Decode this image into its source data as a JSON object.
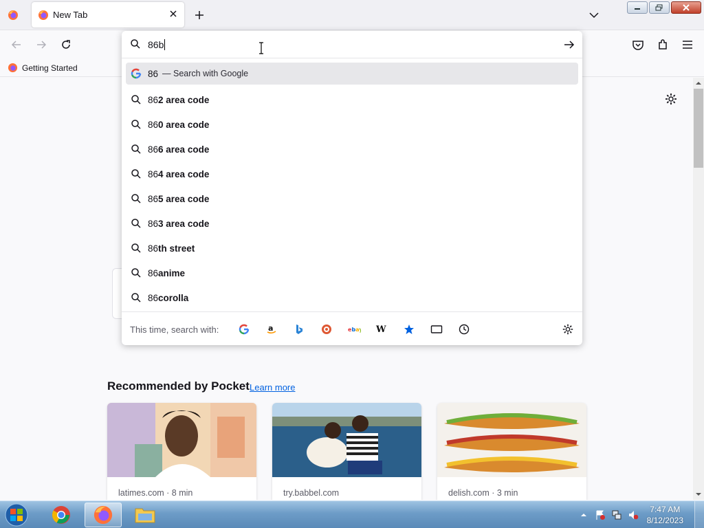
{
  "browser": {
    "tab": {
      "title": "New Tab"
    },
    "bookmarks": [
      {
        "label": "Getting Started"
      }
    ]
  },
  "urlbar": {
    "typed": "86b",
    "suggestions": [
      {
        "typed": "86",
        "completion": "",
        "action": "— Search with Google",
        "icon": "google-icon",
        "active": true
      },
      {
        "typed": "86",
        "completion": "2 area code",
        "icon": "search-icon"
      },
      {
        "typed": "86",
        "completion": "0 area code",
        "icon": "search-icon"
      },
      {
        "typed": "86",
        "completion": "6 area code",
        "icon": "search-icon"
      },
      {
        "typed": "86",
        "completion": "4 area code",
        "icon": "search-icon"
      },
      {
        "typed": "86",
        "completion": "5 area code",
        "icon": "search-icon"
      },
      {
        "typed": "86",
        "completion": "3 area code",
        "icon": "search-icon"
      },
      {
        "typed": "86",
        "completion": "th street",
        "icon": "search-icon"
      },
      {
        "typed": "86 ",
        "completion": "anime",
        "icon": "search-icon"
      },
      {
        "typed": "86 ",
        "completion": "corolla",
        "icon": "search-icon"
      }
    ],
    "oneoff_label": "This time, search with:",
    "oneoff_engines": [
      "google",
      "amazon",
      "bing",
      "duckduckgo",
      "ebay",
      "wikipedia",
      "bookmarks",
      "tabs",
      "history"
    ]
  },
  "pocket": {
    "title": "Recommended by Pocket",
    "learn_more": "Learn more",
    "cards": [
      {
        "source": "latimes.com · 8 min"
      },
      {
        "source": "try.babbel.com"
      },
      {
        "source": "delish.com · 3 min"
      }
    ]
  },
  "taskbar": {
    "time": "7:47 AM",
    "date": "8/12/2023"
  },
  "colors": {
    "accent": "#0061e0",
    "highlight": "#e7e7ea"
  }
}
